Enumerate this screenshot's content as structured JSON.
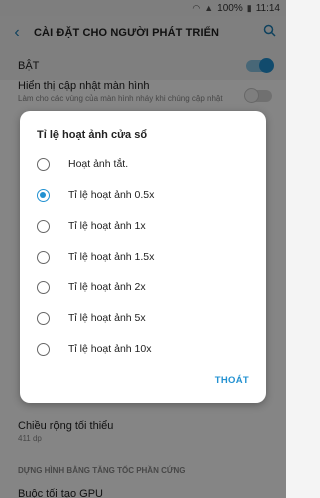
{
  "status_bar": {
    "battery": "100%",
    "time": "11:14"
  },
  "header": {
    "title": "CÀI ĐẶT CHO NGƯỜI PHÁT TRIỂN"
  },
  "master_switch": {
    "label": "BẬT",
    "state": "on"
  },
  "background_list": {
    "row_show_updates": {
      "title": "Hiển thị cập nhật màn hình",
      "subtitle": "Làm cho các vùng của màn hình nháy khi chúng cập nhật",
      "toggle": "off"
    },
    "row_min_width": {
      "title": "Chiều rộng tối thiểu",
      "value": "411 dp"
    },
    "section_hw": "DỰNG HÌNH BẰNG TĂNG TỐC PHẦN CỨNG",
    "row_partial": "Buộc tối tạo GPU"
  },
  "dialog": {
    "title": "Tỉ lệ hoạt ảnh cửa sổ",
    "options": [
      {
        "label": "Hoạt ảnh tắt.",
        "selected": false
      },
      {
        "label": "Tỉ lệ hoạt ảnh 0.5x",
        "selected": true
      },
      {
        "label": "Tỉ lệ hoạt ảnh 1x",
        "selected": false
      },
      {
        "label": "Tỉ lệ hoạt ảnh 1.5x",
        "selected": false
      },
      {
        "label": "Tỉ lệ hoạt ảnh 2x",
        "selected": false
      },
      {
        "label": "Tỉ lệ hoạt ảnh 5x",
        "selected": false
      },
      {
        "label": "Tỉ lệ hoạt ảnh 10x",
        "selected": false
      }
    ],
    "close_label": "THOÁT"
  },
  "colors": {
    "accent": "#2291d1",
    "scrim": "rgba(0,0,0,0.48)"
  }
}
